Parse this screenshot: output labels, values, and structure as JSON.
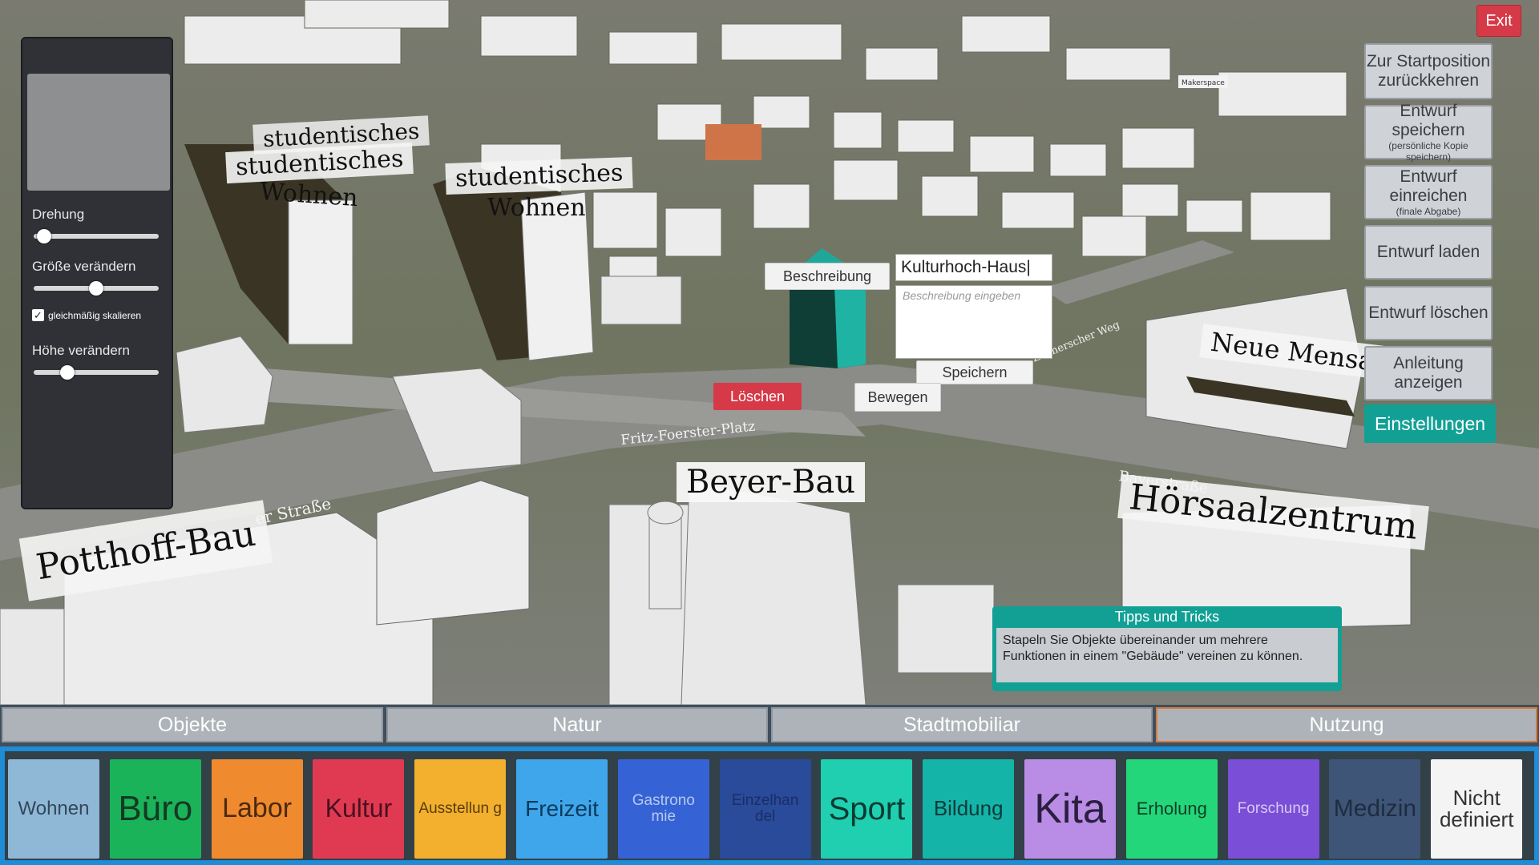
{
  "map_labels": {
    "studentisches_1": "studentisches",
    "studentisches_2": "studentisches",
    "wohnen_1": "Wohnen",
    "studentisches_3": "studentisches",
    "wohnen_2": "Wohnen",
    "neue_mensa": "Neue Mensa",
    "beyer_bau": "Beyer-Bau",
    "hoersaalzentrum": "Hörsaalzentrum",
    "potthoff_bau": "Potthoff-Bau",
    "fritz_foerster_platz": "Fritz-Foerster-Platz",
    "strasse_left": "er Straße",
    "bayerstrasse": "Bayerstraße",
    "zeuner_weg": "Zeunerscher Weg",
    "makerspace": "Makerspace"
  },
  "side_panel": {
    "rotation_label": "Drehung",
    "size_label": "Größe verändern",
    "uniform_scale_label": "gleichmäßig skalieren",
    "height_label": "Höhe verändern",
    "rotation_value": 0.03,
    "size_value": 0.5,
    "height_value": 0.24,
    "uniform_scale_checked": true
  },
  "right_menu": {
    "exit": "Exit",
    "reset_line1": "Zur Startposition",
    "reset_line2": "zurückkehren",
    "save": "Entwurf speichern",
    "save_sub": "(persönliche Kopie speichern)",
    "submit": "Entwurf einreichen",
    "submit_sub": "(finale Abgabe)",
    "load": "Entwurf laden",
    "delete": "Entwurf löschen",
    "guide": "Anleitung anzeigen",
    "settings": "Einstellungen"
  },
  "object_editor": {
    "description_button": "Beschreibung",
    "name_value": "Kulturhoch-Haus",
    "description_placeholder": "Beschreibung eingeben",
    "save_button": "Speichern",
    "delete_button": "Löschen",
    "move_button": "Bewegen"
  },
  "tips": {
    "title": "Tipps und Tricks",
    "text": "Stapeln Sie Objekte übereinander um mehrere Funktionen in einem \"Gebäude\" vereinen zu können."
  },
  "tabs": [
    "Objekte",
    "Natur",
    "Stadtmobiliar",
    "Nutzung"
  ],
  "active_tab": "Nutzung",
  "usages": [
    {
      "label": "Wohnen",
      "color": "#8fb8d6"
    },
    {
      "label": "Büro",
      "color": "#1bb35a"
    },
    {
      "label": "Labor",
      "color": "#f08a2e"
    },
    {
      "label": "Kultur",
      "color": "#e03a52"
    },
    {
      "label": "Ausstellun g",
      "color": "#f2b02e"
    },
    {
      "label": "Freizeit",
      "color": "#3fa6ec"
    },
    {
      "label": "Gastrono mie",
      "color": "#3563d6"
    },
    {
      "label": "Einzelhan del",
      "color": "#2a4a9a"
    },
    {
      "label": "Sport",
      "color": "#1fcfb0"
    },
    {
      "label": "Bildung",
      "color": "#14b4a8"
    },
    {
      "label": "Kita",
      "color": "#b98de6"
    },
    {
      "label": "Erholung",
      "color": "#24d67a"
    },
    {
      "label": "Forschung",
      "color": "#7a4ed6"
    },
    {
      "label": "Medizin",
      "color": "#3e5577"
    },
    {
      "label": "Nicht definiert",
      "color": "#f4f4f4"
    }
  ]
}
